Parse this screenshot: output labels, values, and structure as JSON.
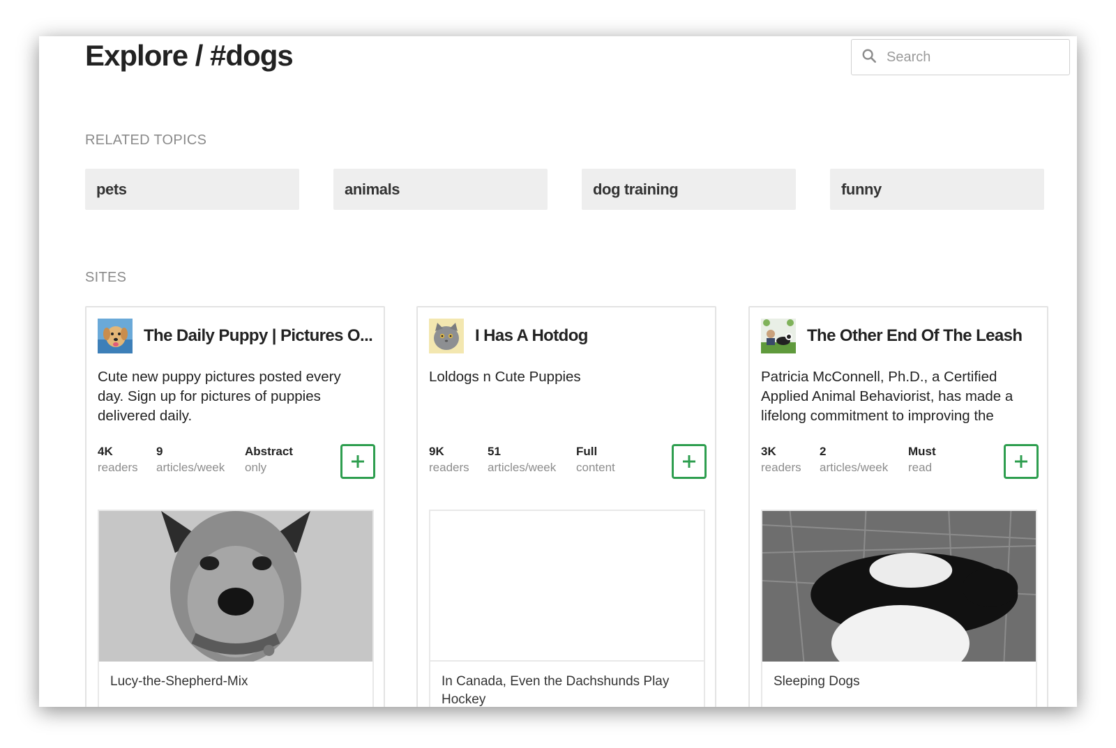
{
  "header": {
    "title": "Explore / #dogs",
    "search_placeholder": "Search"
  },
  "related_topics": {
    "label": "RELATED TOPICS",
    "items": [
      {
        "label": "pets"
      },
      {
        "label": "animals"
      },
      {
        "label": "dog training"
      },
      {
        "label": "funny"
      }
    ]
  },
  "sites": {
    "label": "SITES",
    "items": [
      {
        "title": "The Daily Puppy | Pictures O...",
        "description": "Cute new puppy pictures posted every day. Sign up for pictures of puppies delivered daily.",
        "stats": [
          {
            "value": "4K",
            "label": "readers"
          },
          {
            "value": "9",
            "label": "articles/week"
          },
          {
            "value": "Abstract",
            "label": "only"
          }
        ],
        "article_title": "Lucy-the-Shepherd-Mix"
      },
      {
        "title": "I Has A Hotdog",
        "description": "Loldogs n Cute Puppies",
        "stats": [
          {
            "value": "9K",
            "label": "readers"
          },
          {
            "value": "51",
            "label": "articles/week"
          },
          {
            "value": "Full",
            "label": "content"
          }
        ],
        "article_title": "In Canada, Even the Dachshunds Play Hockey"
      },
      {
        "title": "The Other End Of The Leash",
        "description": "Patricia McConnell, Ph.D., a Certified Applied Animal Behaviorist, has made a lifelong commitment to improving the",
        "stats": [
          {
            "value": "3K",
            "label": "readers"
          },
          {
            "value": "2",
            "label": "articles/week"
          },
          {
            "value": "Must",
            "label": "read"
          }
        ],
        "article_title": "Sleeping Dogs"
      }
    ]
  },
  "colors": {
    "follow_accent": "#2e9e4f",
    "chip_bg": "#eeeeee",
    "muted_text": "#8a8a8a"
  },
  "icons": {
    "search": "search-icon",
    "follow": "plus-icon"
  }
}
